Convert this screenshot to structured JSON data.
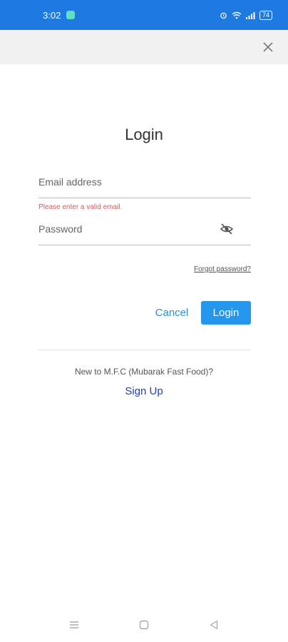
{
  "status_bar": {
    "time": "3:02",
    "battery": "74"
  },
  "page": {
    "title": "Login"
  },
  "form": {
    "email_placeholder": "Email address",
    "email_error": "Please enter a valid email.",
    "password_placeholder": "Password",
    "forgot_label": "Forgot password?",
    "cancel_label": "Cancel",
    "login_label": "Login"
  },
  "footer": {
    "new_to_text": "New to M.F.C (Mubarak Fast Food)?",
    "signup_label": "Sign Up"
  },
  "icons": {
    "close": "close-icon",
    "eye_off": "eye-off-icon",
    "nav_menu": "menu-icon",
    "nav_home": "home-icon",
    "nav_back": "back-icon"
  },
  "colors": {
    "status_bar": "#1e7ae0",
    "primary": "#2596ee",
    "error": "#d25b5b",
    "link": "#1f3fbf"
  }
}
